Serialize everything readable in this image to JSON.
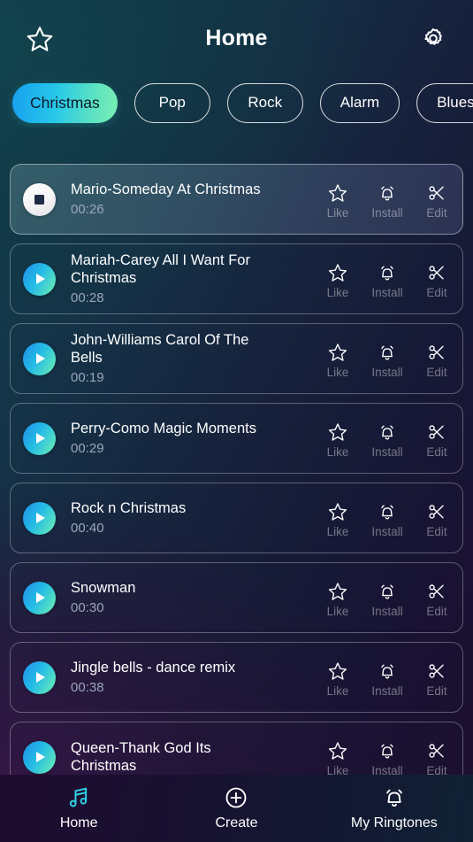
{
  "header": {
    "title": "Home",
    "favorites_icon": "star-outline-icon",
    "settings_icon": "gear-icon"
  },
  "categories": {
    "items": [
      {
        "label": "Christmas",
        "active": true
      },
      {
        "label": "Pop",
        "active": false
      },
      {
        "label": "Rock",
        "active": false
      },
      {
        "label": "Alarm",
        "active": false
      },
      {
        "label": "Blues &",
        "active": false
      }
    ],
    "active_chip_gradient_start": "#18a0f0",
    "active_chip_gradient_end": "#7aeeb4"
  },
  "actions": {
    "like_label": "Like",
    "install_label": "Install",
    "edit_label": "Edit",
    "like_icon": "star-outline-icon",
    "install_icon": "bell-outline-icon",
    "edit_icon": "scissors-icon"
  },
  "songs": [
    {
      "title": "Mario-Someday At Christmas",
      "duration": "00:26",
      "playing": true
    },
    {
      "title": "Mariah-Carey All I Want For Christmas",
      "duration": "00:28",
      "playing": false
    },
    {
      "title": "John-Williams Carol Of The Bells",
      "duration": "00:19",
      "playing": false
    },
    {
      "title": "Perry-Como Magic Moments",
      "duration": "00:29",
      "playing": false
    },
    {
      "title": "Rock n Christmas",
      "duration": "00:40",
      "playing": false
    },
    {
      "title": "Snowman",
      "duration": "00:30",
      "playing": false
    },
    {
      "title": "Jingle bells - dance remix",
      "duration": "00:38",
      "playing": false
    },
    {
      "title": "Queen-Thank God Its Christmas",
      "duration": "",
      "playing": false
    }
  ],
  "bottom_nav": {
    "items": [
      {
        "label": "Home",
        "icon": "music-note-icon",
        "active": true
      },
      {
        "label": "Create",
        "icon": "plus-circle-icon",
        "active": false
      },
      {
        "label": "My Ringtones",
        "icon": "bell-icon",
        "active": false
      }
    ],
    "active_color": "#2fd0e8"
  }
}
